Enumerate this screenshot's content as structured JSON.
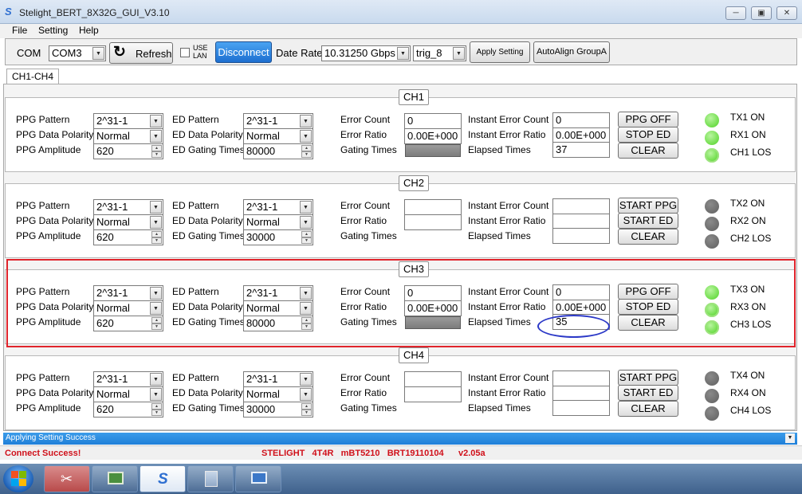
{
  "window": {
    "title": "Stelight_BERT_8X32G_GUI_V3.10",
    "app_icon": "S"
  },
  "menu": [
    "File",
    "Setting",
    "Help"
  ],
  "toolbar": {
    "com_label": "COM",
    "com_value": "COM3",
    "refresh_label": "Refresh",
    "use_lan_label": "USE LAN",
    "disconnect_label": "Disconnect",
    "date_rate_label": "Date Rate",
    "date_rate_value": "10.31250 Gbps",
    "trig_value": "trig_8",
    "apply_label": "Apply Setting",
    "autoalign_label": "AutoAlign GroupA"
  },
  "tab": "CH1-CH4",
  "labels": {
    "ppg_pattern": "PPG Pattern",
    "ppg_polarity": "PPG Data Polarity",
    "ppg_amplitude": "PPG Amplitude",
    "ed_pattern": "ED Pattern",
    "ed_polarity": "ED Data Polarity",
    "ed_gating": "ED Gating Times",
    "error_count": "Error Count",
    "error_ratio": "Error Ratio",
    "gating_times": "Gating Times",
    "inst_error_count": "Instant Error Count",
    "inst_error_ratio": "Instant Error Ratio",
    "elapsed_times": "Elapsed Times",
    "clear": "CLEAR"
  },
  "channels": [
    {
      "name": "CH1",
      "ppg_pattern": "2^31-1",
      "ppg_polarity": "Normal",
      "ppg_amplitude": "620",
      "ed_pattern": "2^31-1",
      "ed_polarity": "Normal",
      "ed_gating": "80000",
      "error_count": "0",
      "error_ratio": "0.00E+000",
      "gating_shown": true,
      "inst_error_count": "0",
      "inst_error_ratio": "0.00E+000",
      "elapsed": "37",
      "ppg_btn": "PPG OFF",
      "ed_btn": "STOP ED",
      "tx_label": "TX1 ON",
      "rx_label": "RX1 ON",
      "los_label": "CH1 LOS",
      "tx_state": "on",
      "rx_state": "on",
      "los_state": "los"
    },
    {
      "name": "CH2",
      "ppg_pattern": "2^31-1",
      "ppg_polarity": "Normal",
      "ppg_amplitude": "620",
      "ed_pattern": "2^31-1",
      "ed_polarity": "Normal",
      "ed_gating": "30000",
      "error_count": "",
      "error_ratio": "",
      "gating_shown": false,
      "inst_error_count": "",
      "inst_error_ratio": "",
      "elapsed": "",
      "ppg_btn": "START PPG",
      "ed_btn": "START ED",
      "tx_label": "TX2 ON",
      "rx_label": "RX2 ON",
      "los_label": "CH2 LOS",
      "tx_state": "off",
      "rx_state": "off",
      "los_state": "off"
    },
    {
      "name": "CH3",
      "ppg_pattern": "2^31-1",
      "ppg_polarity": "Normal",
      "ppg_amplitude": "620",
      "ed_pattern": "2^31-1",
      "ed_polarity": "Normal",
      "ed_gating": "80000",
      "error_count": "0",
      "error_ratio": "0.00E+000",
      "gating_shown": true,
      "inst_error_count": "0",
      "inst_error_ratio": "0.00E+000",
      "elapsed": "35",
      "ppg_btn": "PPG OFF",
      "ed_btn": "STOP ED",
      "tx_label": "TX3 ON",
      "rx_label": "RX3 ON",
      "los_label": "CH3 LOS",
      "tx_state": "on",
      "rx_state": "los",
      "los_state": "los"
    },
    {
      "name": "CH4",
      "ppg_pattern": "2^31-1",
      "ppg_polarity": "Normal",
      "ppg_amplitude": "620",
      "ed_pattern": "2^31-1",
      "ed_polarity": "Normal",
      "ed_gating": "30000",
      "error_count": "",
      "error_ratio": "",
      "gating_shown": false,
      "inst_error_count": "",
      "inst_error_ratio": "",
      "elapsed": "",
      "ppg_btn": "START PPG",
      "ed_btn": "START ED",
      "tx_label": "TX4 ON",
      "rx_label": "RX4 ON",
      "los_label": "CH4 LOS",
      "tx_state": "off",
      "rx_state": "off",
      "los_state": "off"
    }
  ],
  "status_bar": "Applying Setting Success",
  "footer": {
    "connect_status": "Connect Success!",
    "device_info": "STELIGHT   4T4R   mBT5210   BRT19110104      v2.05a"
  },
  "colors": {
    "highlight_box": "#e0242c",
    "annotation_ellipse": "#2c39c7",
    "status_bar": "#2a8be0",
    "connect_text": "#d0101a"
  },
  "taskbar": {
    "icons": [
      "windows-start-icon",
      "scissors-tool-icon",
      "network-monitor-icon",
      "stelight-app-icon",
      "calculator-icon",
      "remote-desktop-icon"
    ]
  }
}
